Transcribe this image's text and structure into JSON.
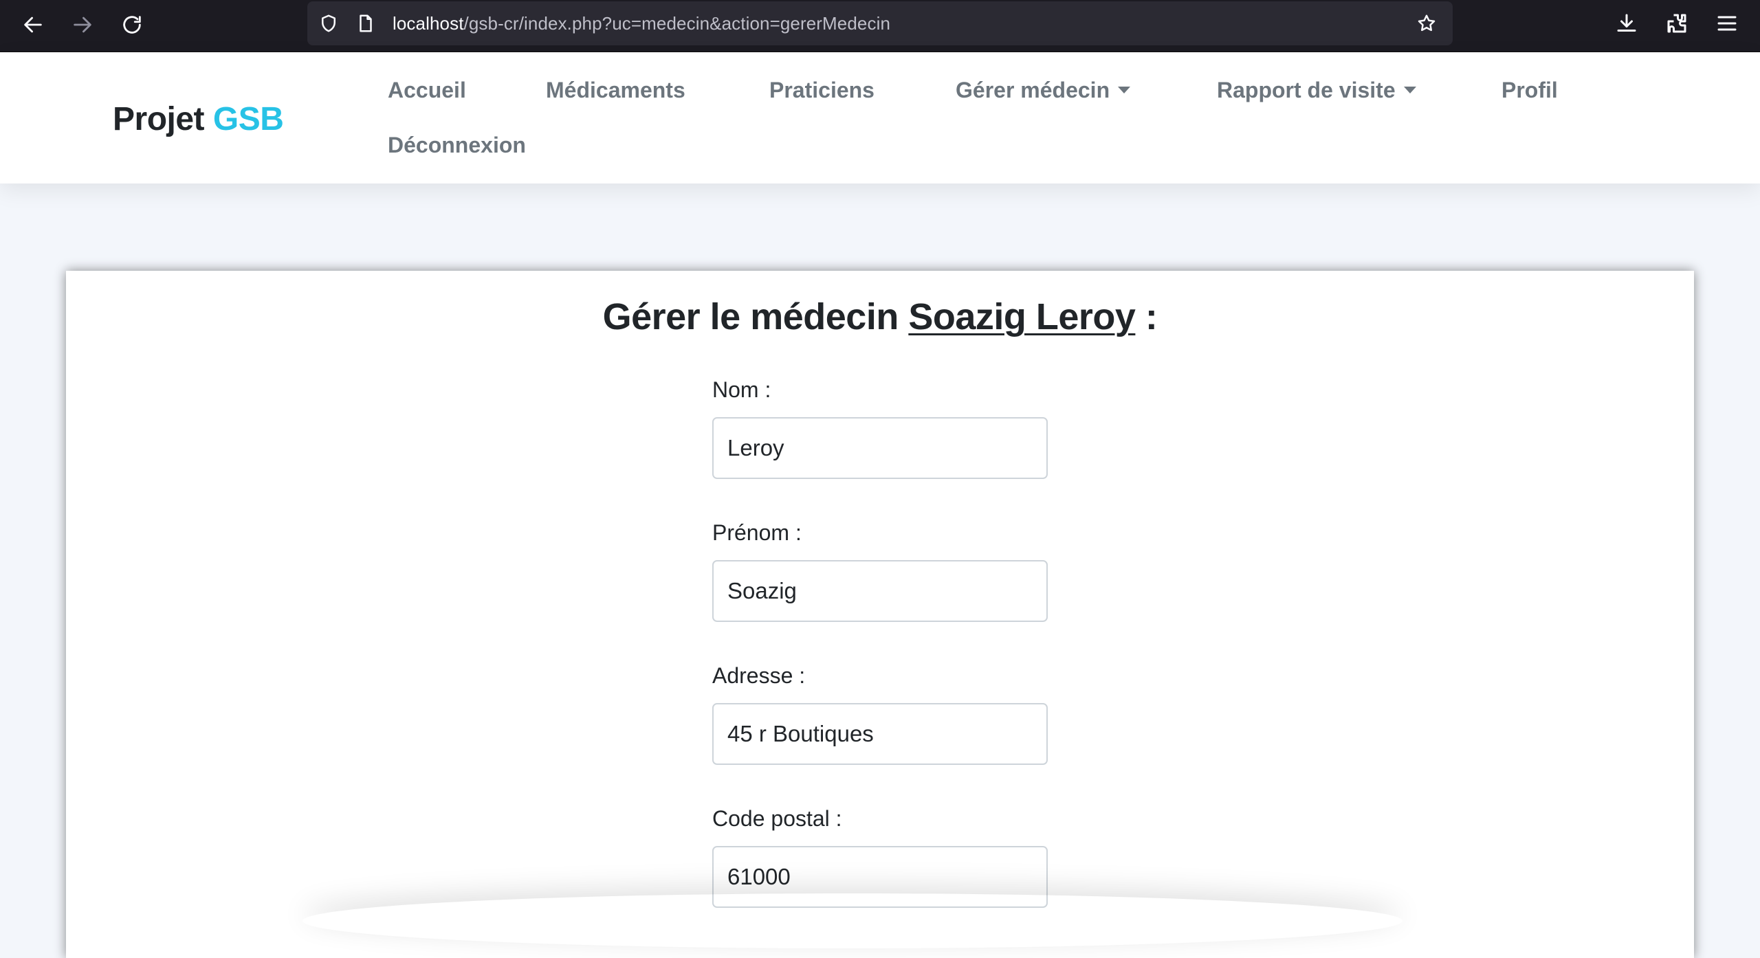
{
  "browser": {
    "url_host": "localhost",
    "url_path": "/gsb-cr/index.php?uc=medecin&action=gererMedecin"
  },
  "navbar": {
    "brand_prefix": "Projet",
    "brand_accent": "GSB",
    "links": [
      {
        "label": "Accueil"
      },
      {
        "label": "Médicaments"
      },
      {
        "label": "Praticiens"
      },
      {
        "label": "Gérer médecin"
      },
      {
        "label": "Rapport de visite"
      },
      {
        "label": "Profil"
      },
      {
        "label": "Déconnexion"
      }
    ]
  },
  "form": {
    "title_prefix": "Gérer le médecin",
    "title_name": "Soazig Leroy",
    "title_suffix": ":",
    "fields": [
      {
        "label": "Nom :",
        "value": "Leroy"
      },
      {
        "label": "Prénom :",
        "value": "Soazig"
      },
      {
        "label": "Adresse :",
        "value": "45 r Boutiques"
      },
      {
        "label": "Code postal :",
        "value": "61000"
      }
    ]
  },
  "colors": {
    "brand_accent": "#27c2e6",
    "nav_link": "#6c757d",
    "page_bg": "#f3f6fb"
  }
}
